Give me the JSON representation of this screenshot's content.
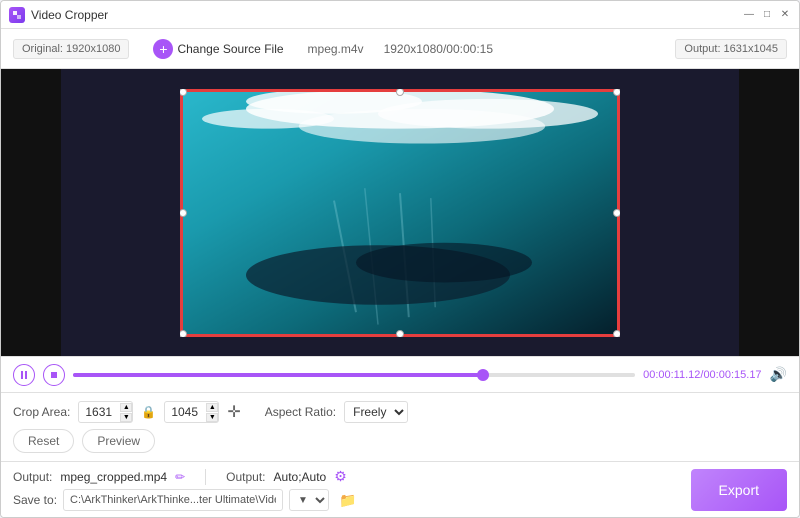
{
  "titleBar": {
    "appName": "Video Cropper",
    "minBtn": "—",
    "maxBtn": "□",
    "closeBtn": "✕"
  },
  "topBar": {
    "originalLabel": "Original: 1920x1080",
    "changeSourceBtn": "Change Source File",
    "fileName": "mpeg.m4v",
    "fileInfo": "1920x1080/00:00:15",
    "outputLabel": "Output: 1631x1045"
  },
  "playback": {
    "timeDisplay": "00:00:11.12/00:00:15.17"
  },
  "controls": {
    "cropLabel": "Crop Area:",
    "cropWidth": "1631",
    "cropHeight": "1045",
    "aspectLabel": "Aspect Ratio:",
    "aspectValue": "Freely",
    "resetBtn": "Reset",
    "previewBtn": "Preview"
  },
  "bottomBar": {
    "outputLabel": "Output:",
    "outputFile": "mpeg_cropped.mp4",
    "outputSettingsLabel": "Output:",
    "outputSettingsValue": "Auto;Auto",
    "saveToLabel": "Save to:",
    "savePath": "C:\\ArkThinker\\ArkThinke...ter Ultimate\\Video Crop",
    "exportBtn": "Export"
  }
}
